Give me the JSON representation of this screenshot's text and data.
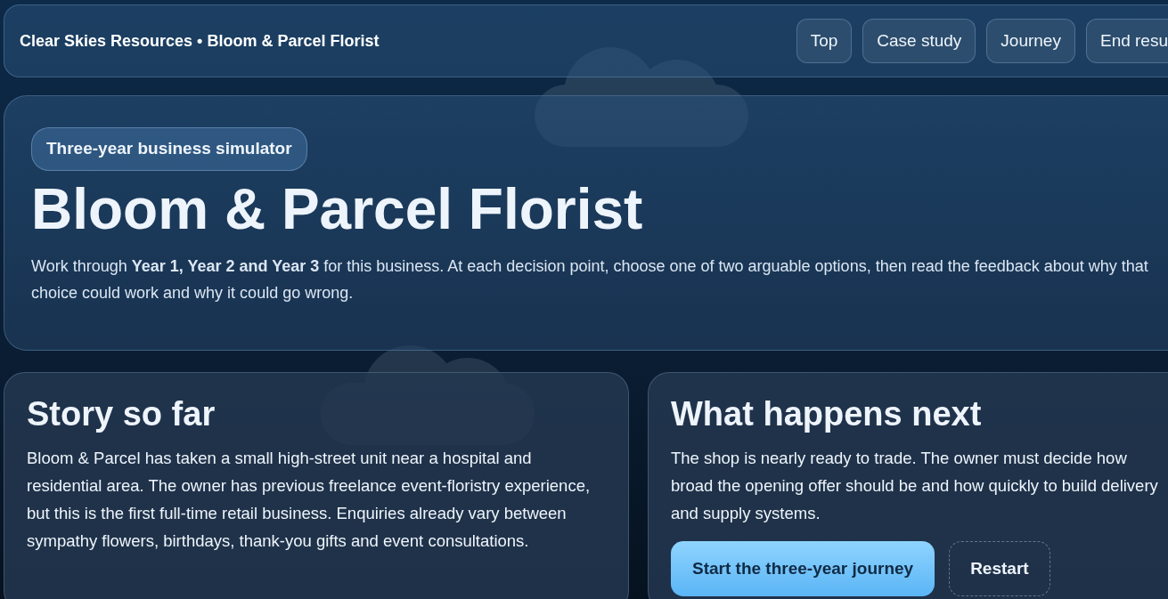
{
  "header": {
    "brand": "Clear Skies Resources • Bloom & Parcel Florist",
    "nav": [
      {
        "label": "Top"
      },
      {
        "label": "Case study"
      },
      {
        "label": "Journey"
      },
      {
        "label": "End resu"
      }
    ]
  },
  "hero": {
    "badge": "Three-year business simulator",
    "title": "Bloom & Parcel Florist",
    "intro": "Work through **Year 1, Year 2 and Year 3** for this business. At each decision point, choose one of two arguable options, then read the feedback about why that choice could work and why it could go wrong."
  },
  "story": {
    "title": "Story so far",
    "text": "Bloom & Parcel has taken a small high-street unit near a hospital and residential area. The owner has previous freelance event-floristry experience, but this is the first full-time retail business. Enquiries already vary between sympathy flowers, birthdays, thank-you gifts and event consultations."
  },
  "next": {
    "title": "What happens next",
    "text": "The shop is nearly ready to trade. The owner must decide how broad the opening offer should be and how quickly to build delivery and supply systems.",
    "buttons": [
      {
        "label": "Start the three-year journey",
        "kind": "primary"
      },
      {
        "label": "Restart",
        "kind": "dashed"
      }
    ]
  }
}
